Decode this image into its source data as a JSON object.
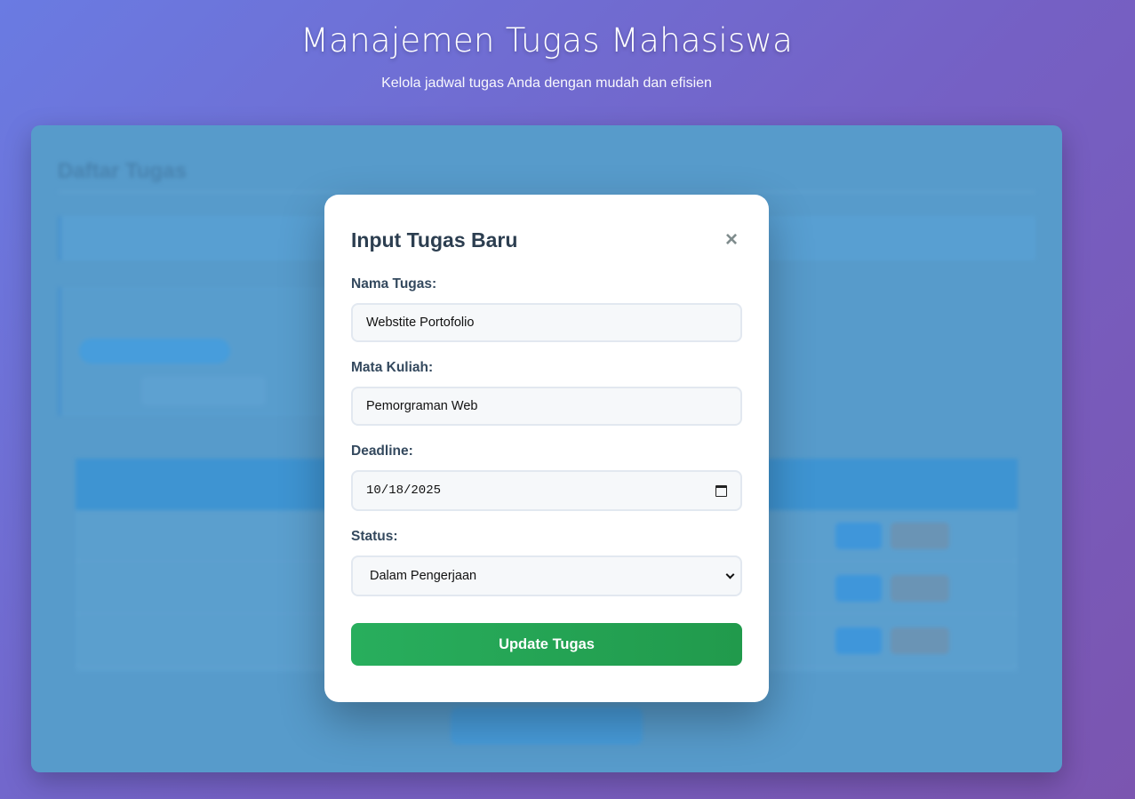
{
  "header": {
    "title": "Manajemen Tugas Mahasiswa",
    "subtitle": "Kelola jadwal tugas Anda dengan mudah dan efisien"
  },
  "background": {
    "list_title": "Daftar Tugas"
  },
  "modal": {
    "title": "Input Tugas Baru",
    "close_icon": "×",
    "fields": {
      "nama_tugas": {
        "label": "Nama Tugas:",
        "value": "Webstite Portofolio"
      },
      "mata_kuliah": {
        "label": "Mata Kuliah:",
        "value": "Pemorgraman Web"
      },
      "deadline": {
        "label": "Deadline:",
        "value": "10/18/2025"
      },
      "status": {
        "label": "Status:",
        "value": "Dalam Pengerjaan"
      }
    },
    "submit_label": "Update Tugas"
  },
  "colors": {
    "accent_green": "#28ae5d",
    "panel_blue": "#579bcb",
    "title_dark": "#2c3e50"
  }
}
